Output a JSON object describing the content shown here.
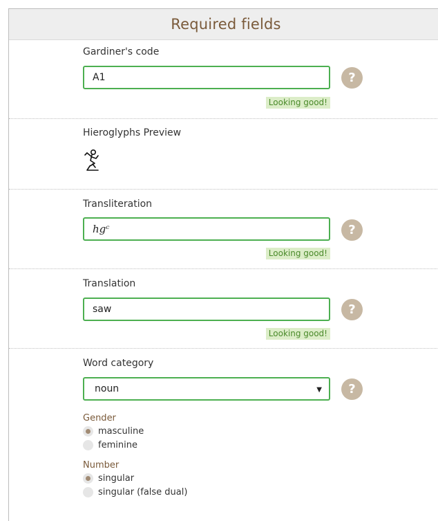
{
  "header": {
    "title": "Required fields"
  },
  "gardiner": {
    "label": "Gardiner's code",
    "value": "A1",
    "status": "Looking good!",
    "help": "?"
  },
  "preview": {
    "label": "Hieroglyphs Preview",
    "glyph": "seated-man-hieroglyph"
  },
  "transliteration": {
    "label": "Transliteration",
    "value": "hgᶜ",
    "status": "Looking good!",
    "help": "?"
  },
  "translation": {
    "label": "Translation",
    "value": "saw",
    "status": "Looking good!",
    "help": "?"
  },
  "category": {
    "label": "Word category",
    "selected": "noun",
    "help": "?"
  },
  "gender": {
    "label": "Gender",
    "options": [
      {
        "label": "masculine",
        "checked": true
      },
      {
        "label": "feminine",
        "checked": false
      }
    ]
  },
  "number": {
    "label": "Number",
    "options": [
      {
        "label": "singular",
        "checked": true
      },
      {
        "label": "singular (false dual)",
        "checked": false
      }
    ]
  },
  "colors": {
    "accent_green": "#4caf50",
    "status_bg": "#dcedc8",
    "brown": "#7a5a3a",
    "help_bg": "#c7b8a3"
  }
}
